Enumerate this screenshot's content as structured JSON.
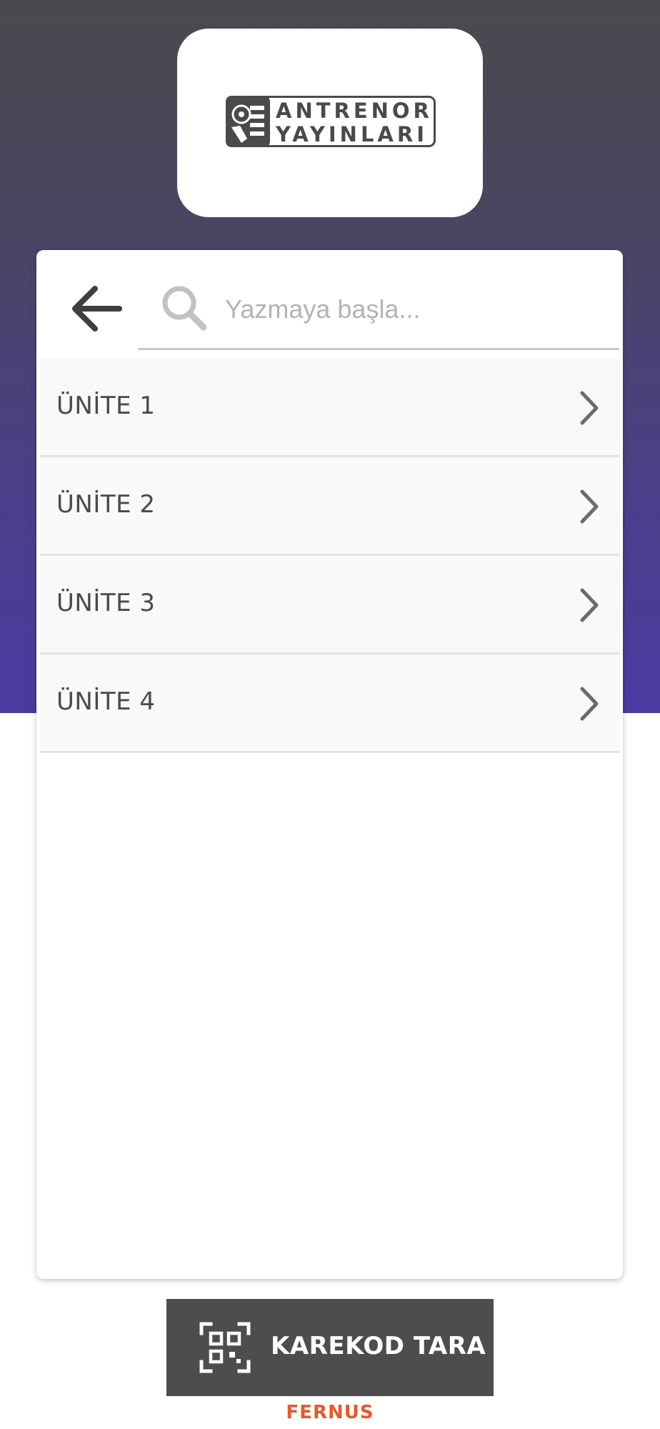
{
  "logo": {
    "line1": "ANTRENOR",
    "line2": "YAYINLARI"
  },
  "search": {
    "placeholder": "Yazmaya başla..."
  },
  "units": [
    {
      "label": "ÜNİTE 1"
    },
    {
      "label": "ÜNİTE 2"
    },
    {
      "label": "ÜNİTE 3"
    },
    {
      "label": "ÜNİTE 4"
    }
  ],
  "scan_button": {
    "label": "KAREKOD TARA"
  },
  "footer": {
    "brand": "FERNUS"
  },
  "colors": {
    "header_gradient_top": "#4a4a4d",
    "header_gradient_bottom": "#4b3aa1",
    "scan_button_bg": "#4d4d4d",
    "brand": "#e8582a"
  }
}
